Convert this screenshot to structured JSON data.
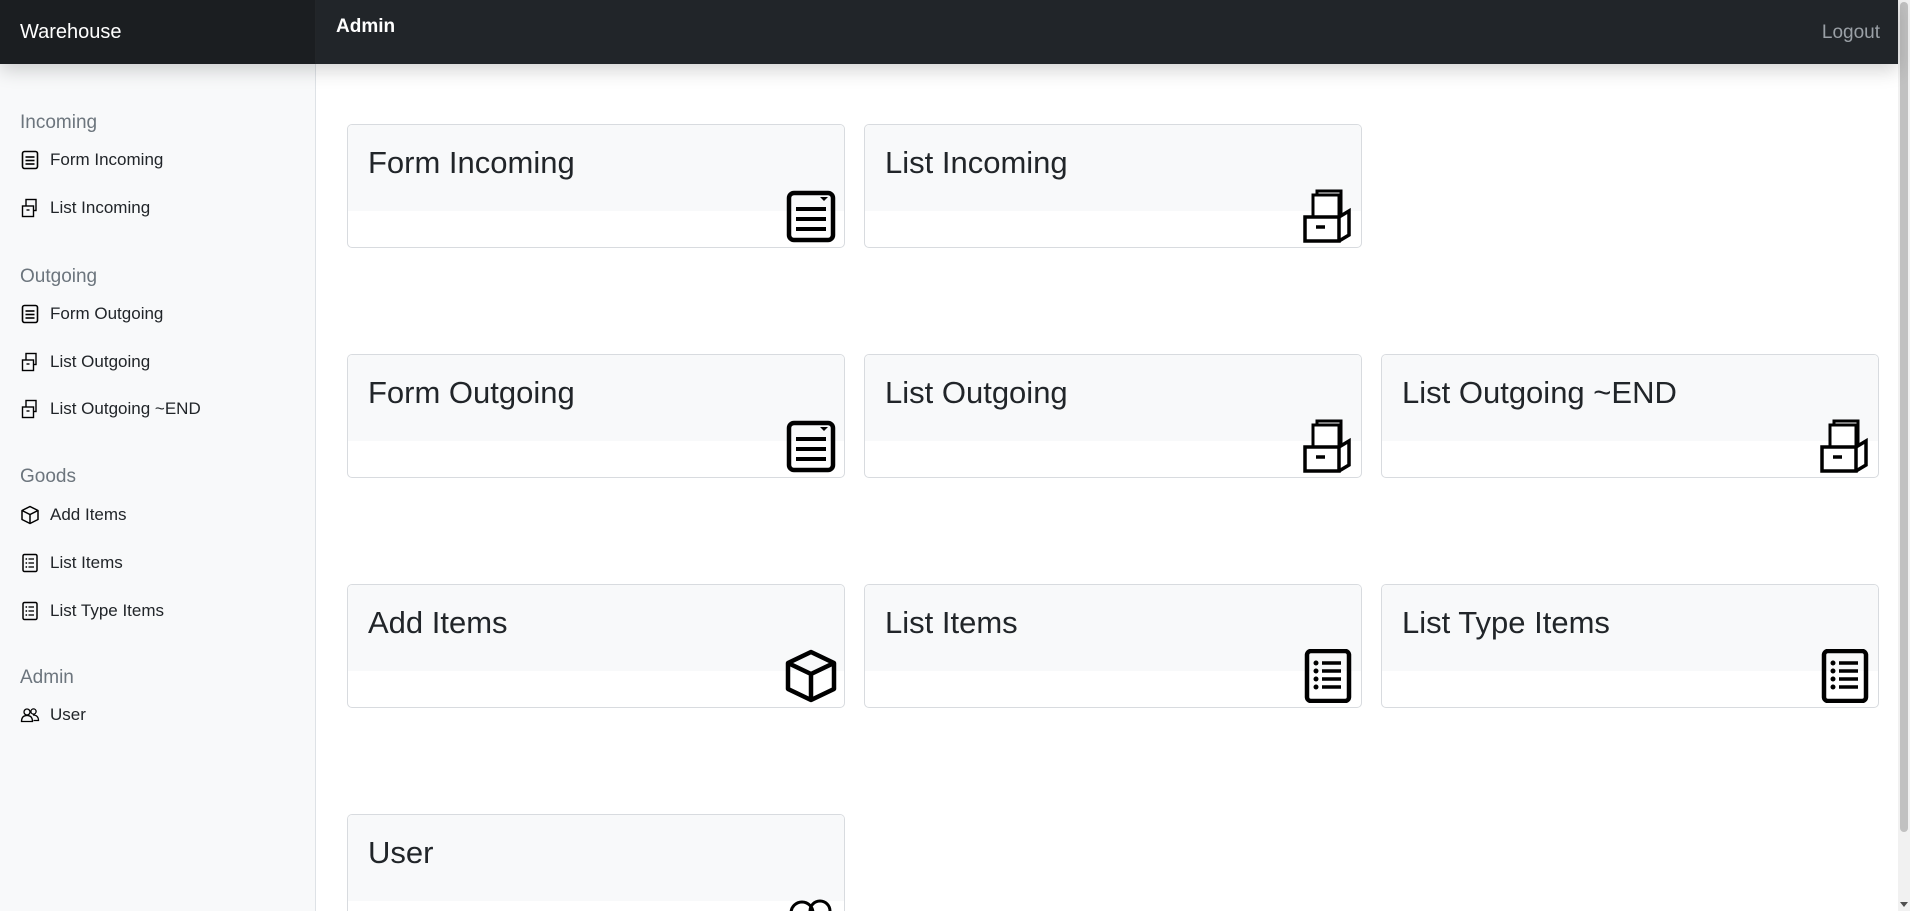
{
  "topbar": {
    "brand": "Warehouse",
    "heading": "Admin",
    "logout_label": "Logout"
  },
  "sidebar": {
    "sections": [
      {
        "heading": "Incoming",
        "items": [
          {
            "label": "Form Incoming",
            "icon": "form-icon"
          },
          {
            "label": "List Incoming",
            "icon": "archive-icon"
          }
        ]
      },
      {
        "heading": "Outgoing",
        "items": [
          {
            "label": "Form Outgoing",
            "icon": "form-icon"
          },
          {
            "label": "List Outgoing",
            "icon": "archive-icon"
          },
          {
            "label": "List Outgoing ~END",
            "icon": "archive-icon"
          }
        ]
      },
      {
        "heading": "Goods",
        "items": [
          {
            "label": "Add Items",
            "icon": "box-icon"
          },
          {
            "label": "List Items",
            "icon": "list-icon"
          },
          {
            "label": "List Type Items",
            "icon": "list-icon"
          }
        ]
      },
      {
        "heading": "Admin",
        "items": [
          {
            "label": "User",
            "icon": "users-icon"
          }
        ]
      }
    ]
  },
  "cards": [
    {
      "title": "Form Incoming",
      "icon": "form-icon"
    },
    {
      "title": "List Incoming",
      "icon": "archive-icon"
    },
    {
      "title": "Form Outgoing",
      "icon": "form-icon"
    },
    {
      "title": "List Outgoing",
      "icon": "archive-icon"
    },
    {
      "title": "List Outgoing ~END",
      "icon": "archive-icon"
    },
    {
      "title": "Add Items",
      "icon": "box-icon"
    },
    {
      "title": "List Items",
      "icon": "list-icon"
    },
    {
      "title": "List Type Items",
      "icon": "list-icon"
    },
    {
      "title": "User",
      "icon": "users-icon"
    }
  ]
}
